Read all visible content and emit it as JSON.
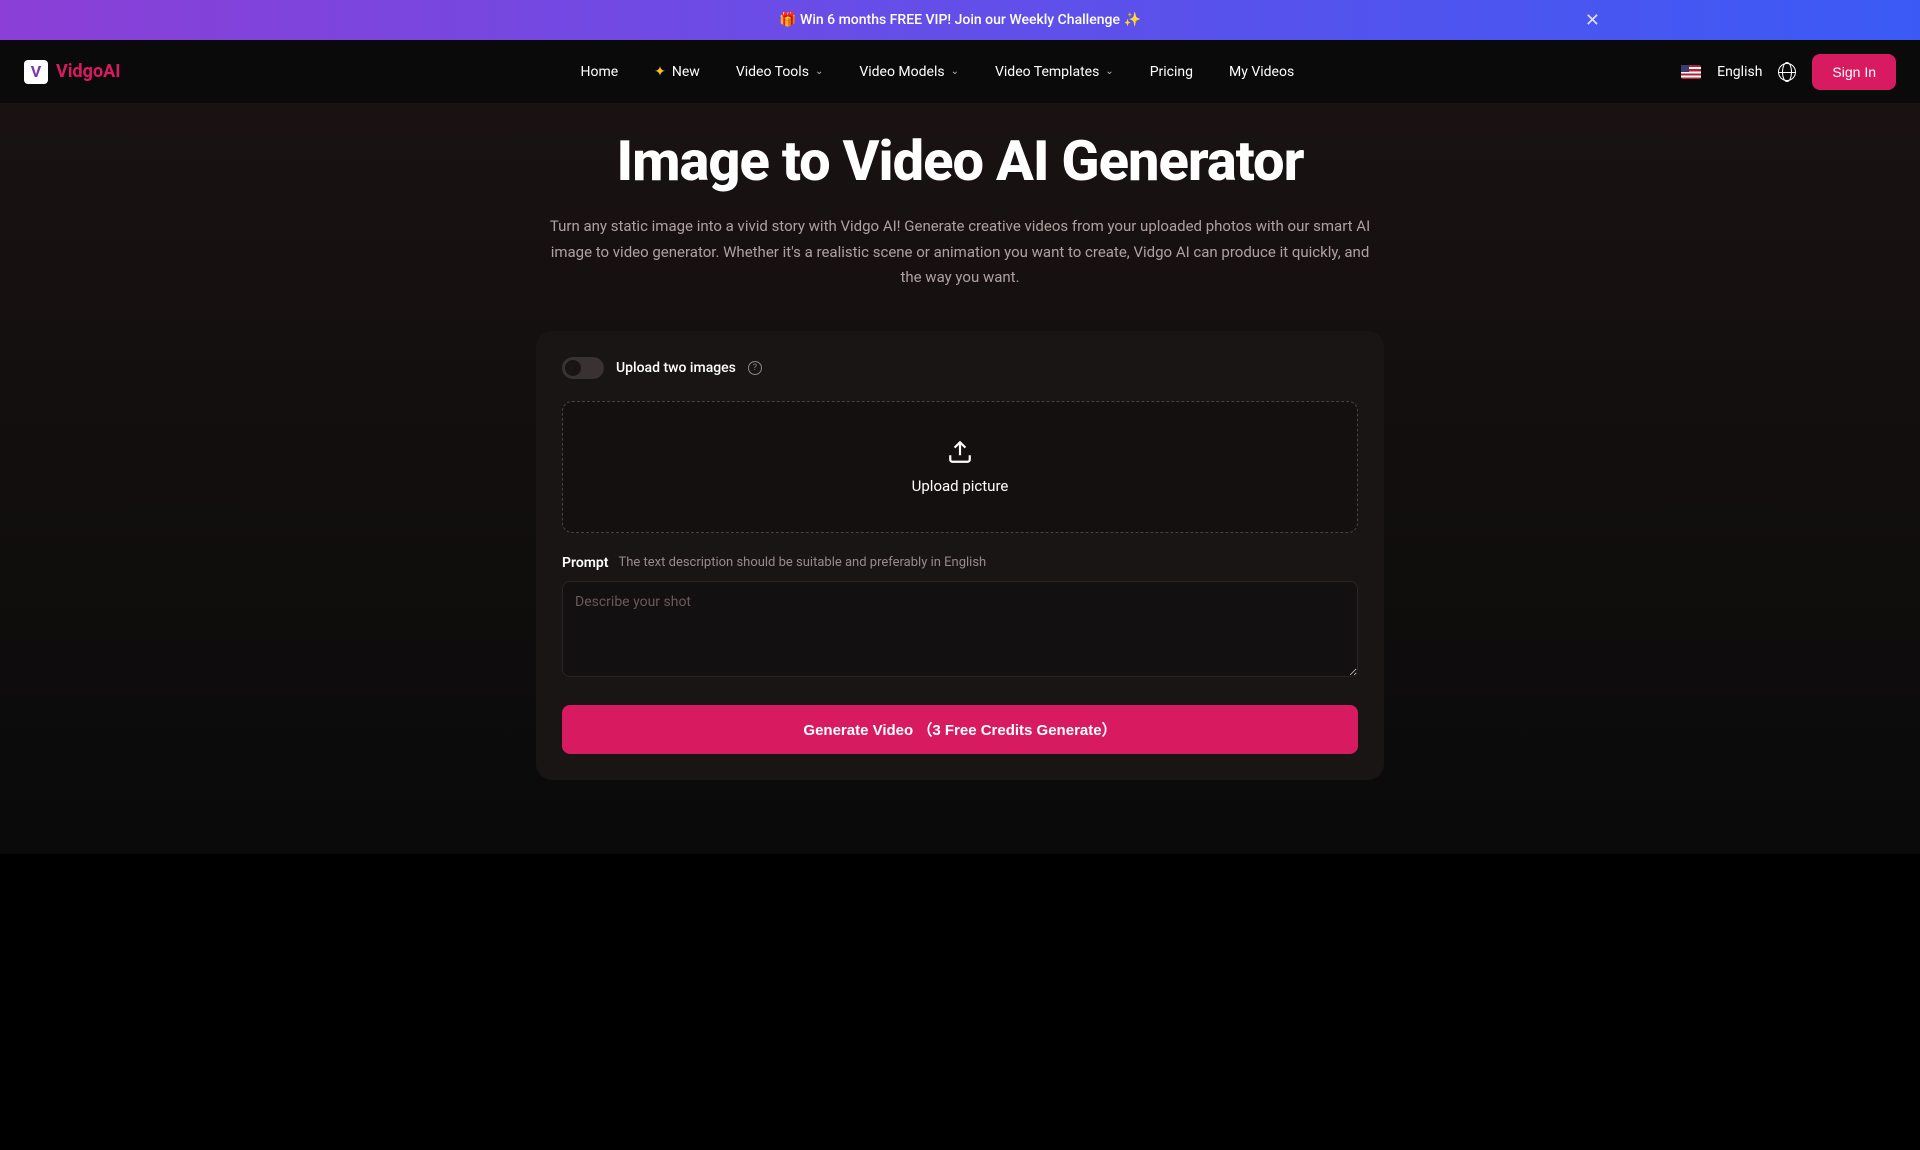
{
  "banner": {
    "text": "🎁 Win 6 months FREE VIP! Join our Weekly Challenge ✨"
  },
  "logo": {
    "letter": "V",
    "text": "VidgoAI"
  },
  "nav": {
    "home": "Home",
    "new": "New",
    "video_tools": "Video Tools",
    "video_models": "Video Models",
    "video_templates": "Video Templates",
    "pricing": "Pricing",
    "my_videos": "My Videos"
  },
  "header_right": {
    "language": "English",
    "signin": "Sign In"
  },
  "hero": {
    "title": "Image to Video AI Generator",
    "subtitle": "Turn any static image into a vivid story with Vidgo AI! Generate creative videos from your uploaded photos with our smart AI image to video generator. Whether it's a realistic scene or animation you want to create, Vidgo AI can produce it quickly, and the way you want."
  },
  "card": {
    "toggle_label": "Upload two images",
    "upload_text": "Upload picture",
    "prompt_label": "Prompt",
    "prompt_hint": "The text description should be suitable and preferably in English",
    "prompt_placeholder": "Describe your shot",
    "generate_button": "Generate Video （3 Free Credits Generate）"
  }
}
